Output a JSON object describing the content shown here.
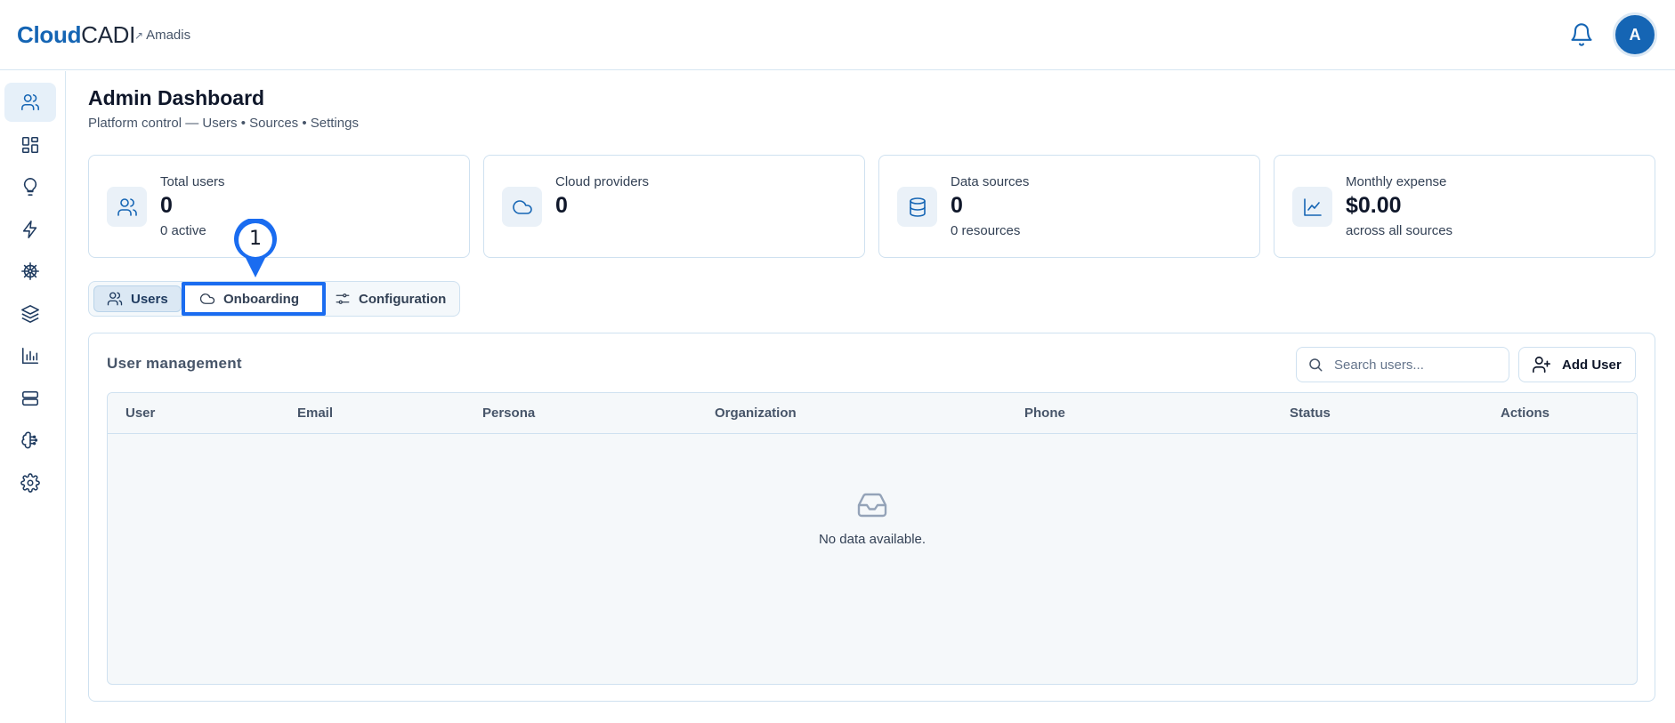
{
  "header": {
    "brand_bold": "Cloud",
    "brand_light": "CADI",
    "tenant_arrow": "↗",
    "tenant": "Amadis",
    "avatar_initial": "A"
  },
  "sidebar": {
    "items": [
      {
        "icon": "users-icon",
        "active": true
      },
      {
        "icon": "dashboard-grid-icon",
        "active": false
      },
      {
        "icon": "lightbulb-icon",
        "active": false
      },
      {
        "icon": "lightning-icon",
        "active": false
      },
      {
        "icon": "helm-wheel-icon",
        "active": false
      },
      {
        "icon": "layers-icon",
        "active": false
      },
      {
        "icon": "bar-chart-icon",
        "active": false
      },
      {
        "icon": "server-icon",
        "active": false
      },
      {
        "icon": "brain-icon",
        "active": false
      },
      {
        "icon": "gear-icon",
        "active": false
      }
    ]
  },
  "page": {
    "title": "Admin Dashboard",
    "subtitle": "Platform control — Users • Sources • Settings"
  },
  "stats": [
    {
      "label": "Total users",
      "value": "0",
      "sub": "0 active",
      "icon": "users-icon"
    },
    {
      "label": "Cloud providers",
      "value": "0",
      "sub": "",
      "icon": "cloud-icon"
    },
    {
      "label": "Data sources",
      "value": "0",
      "sub": "0 resources",
      "icon": "database-icon"
    },
    {
      "label": "Monthly expense",
      "value": "$0.00",
      "sub": "across all sources",
      "icon": "line-chart-icon"
    }
  ],
  "tabs": [
    {
      "label": "Users",
      "icon": "users-icon",
      "active": true
    },
    {
      "label": "Onboarding",
      "icon": "cloud-icon",
      "active": false,
      "highlighted": true
    },
    {
      "label": "Configuration",
      "icon": "sliders-icon",
      "active": false
    }
  ],
  "marker": {
    "number": "1"
  },
  "user_management": {
    "title": "User management",
    "search_placeholder": "Search users...",
    "add_button": "Add User",
    "columns": [
      "User",
      "Email",
      "Persona",
      "Organization",
      "Phone",
      "Status",
      "Actions"
    ],
    "rows": [],
    "empty_text": "No data available."
  },
  "colors": {
    "accent": "#1565b4",
    "highlight": "#1a6cf0",
    "border": "#cfe1f0"
  }
}
